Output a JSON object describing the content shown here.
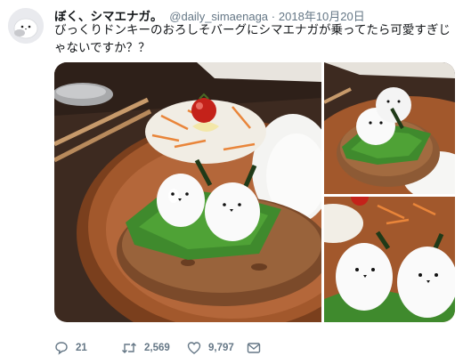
{
  "tweet": {
    "display_name": "ぼく、シマエナガ。",
    "handle": "@daily_simaenaga",
    "separator": "·",
    "date": "2018年10月20日",
    "text": "びっくりドンキーのおろしそバーグにシマエナガが乗ってたら可愛すぎじゃないですか？？"
  },
  "media": {
    "photo_count": 3,
    "icons": [
      "avatar-bird",
      "photo-main",
      "photo-top-right",
      "photo-bottom-right"
    ]
  },
  "actions": {
    "reply_count": "21",
    "retweet_count": "2,569",
    "like_count": "9,797",
    "icons": [
      "reply-icon",
      "retweet-icon",
      "heart-icon",
      "mail-icon"
    ]
  },
  "colors": {
    "text": "#14171a",
    "secondary": "#657786",
    "plate": "#a2582c",
    "table": "#3d2a20"
  }
}
